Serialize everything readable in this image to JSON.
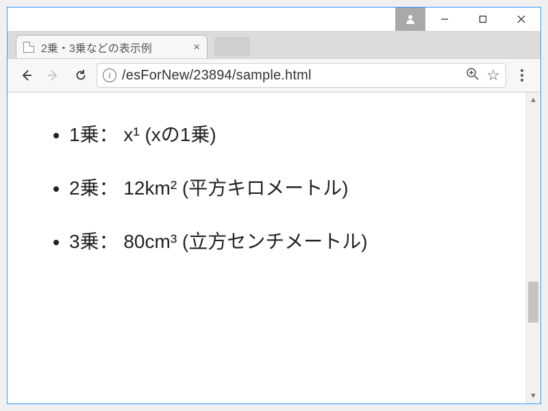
{
  "window": {
    "user_icon": "user",
    "buttons": {
      "minimize": "—",
      "maximize": "▢",
      "close": "✕"
    }
  },
  "tabs": {
    "active": {
      "title": "2乗・3乗などの表示例"
    }
  },
  "toolbar": {
    "url_display": "/esForNew/23894/sample.html"
  },
  "content": {
    "items": [
      {
        "label": "1乗： x¹ (xの1乗)"
      },
      {
        "label": "2乗： 12km² (平方キロメートル)"
      },
      {
        "label": "3乗： 80cm³ (立方センチメートル)"
      }
    ]
  }
}
